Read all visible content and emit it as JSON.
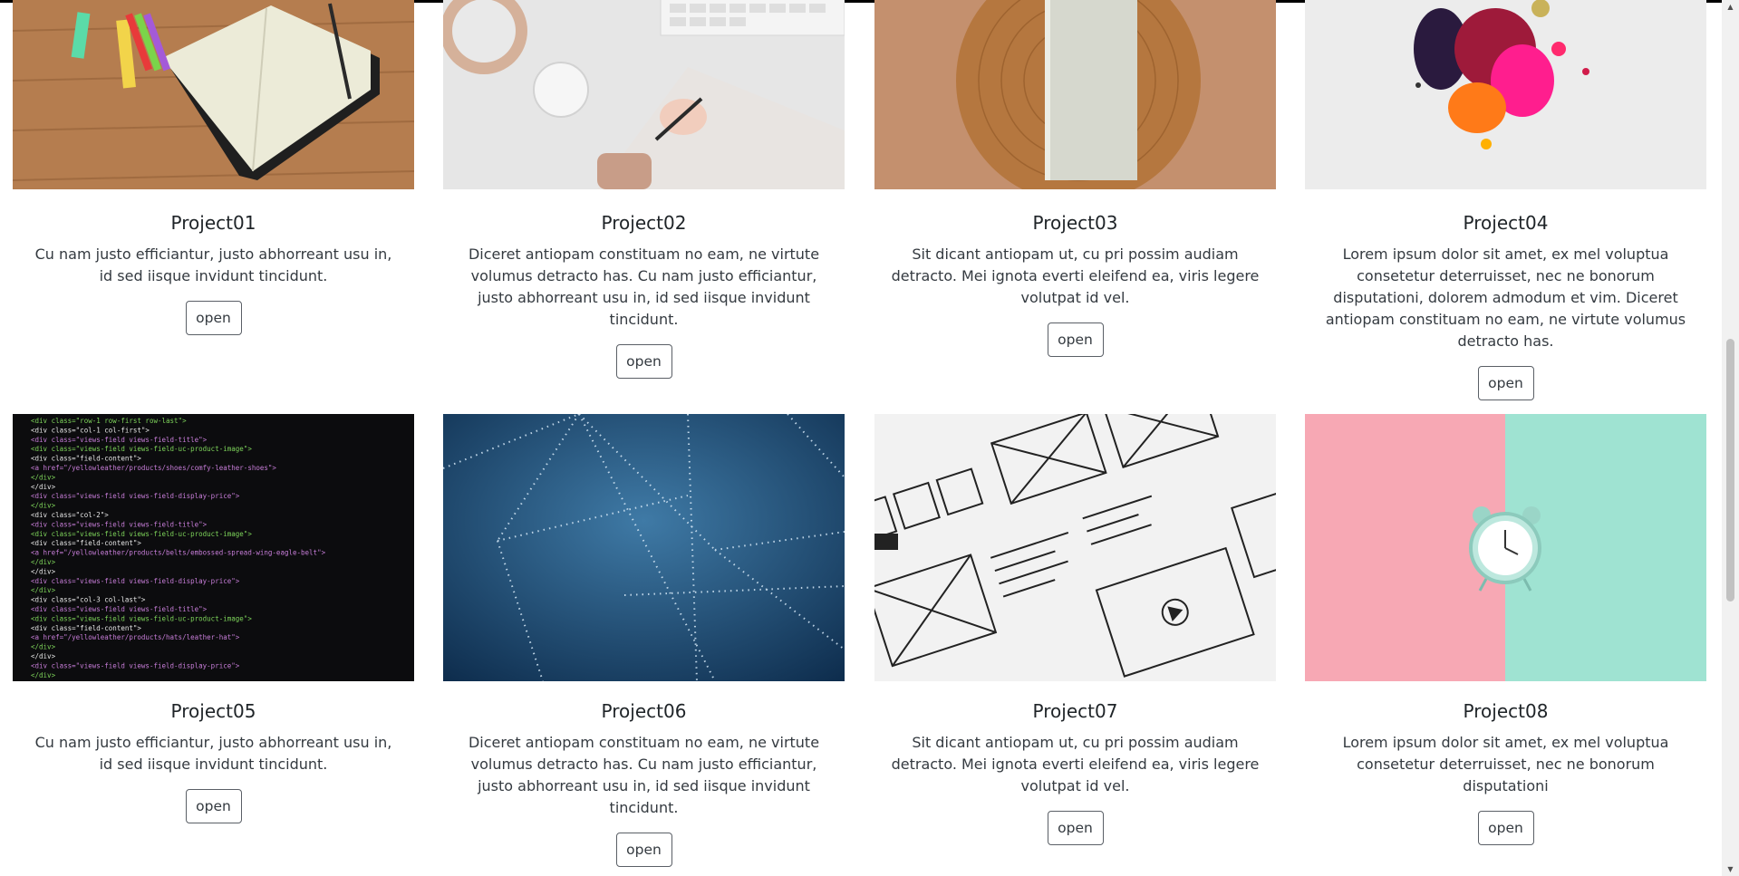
{
  "projects": [
    {
      "title": "Project01",
      "description": "Cu nam justo efficiantur, justo abhorreant usu in, id sed iisque invidunt tincidunt.",
      "button": "open"
    },
    {
      "title": "Project02",
      "description": "Diceret antiopam constituam no eam, ne virtute volumus detracto has. Cu nam justo efficiantur, justo abhorreant usu in, id sed iisque invidunt tincidunt.",
      "button": "open"
    },
    {
      "title": "Project03",
      "description": "Sit dicant antiopam ut, cu pri possim audiam detracto. Mei ignota everti eleifend ea, viris legere volutpat id vel.",
      "button": "open"
    },
    {
      "title": "Project04",
      "description": "Lorem ipsum dolor sit amet, ex mel voluptua consetetur deterruisset, nec ne bonorum disputationi, dolorem admodum et vim. Diceret antiopam constituam no eam, ne virtute volumus detracto has.",
      "button": "open"
    },
    {
      "title": "Project05",
      "description": "Cu nam justo efficiantur, justo abhorreant usu in, id sed iisque invidunt tincidunt.",
      "button": "open"
    },
    {
      "title": "Project06",
      "description": "Diceret antiopam constituam no eam, ne virtute volumus detracto has. Cu nam justo efficiantur, justo abhorreant usu in, id sed iisque invidunt tincidunt.",
      "button": "open"
    },
    {
      "title": "Project07",
      "description": "Sit dicant antiopam ut, cu pri possim audiam detracto. Mei ignota everti eleifend ea, viris legere volutpat id vel.",
      "button": "open"
    },
    {
      "title": "Project08",
      "description": "Lorem ipsum dolor sit amet, ex mel voluptua consetetur deterruisset, nec ne bonorum disputationi",
      "button": "open"
    }
  ],
  "code_lines": [
    "<div class=\"row-1 row-first row-last\">",
    "  <div class=\"col-1 col-first\">",
    "    <div class=\"views-field views-field-title\">",
    "    <div class=\"views-field views-field-uc-product-image\">",
    "      <div class=\"field-content\">",
    "        <a href=\"/yellowleather/products/shoes/comfy-leather-shoes\">",
    "      </div>",
    "    </div>",
    "    <div class=\"views-field views-field-display-price\">",
    "  </div>",
    "  <div class=\"col-2\">",
    "    <div class=\"views-field views-field-title\">",
    "    <div class=\"views-field views-field-uc-product-image\">",
    "      <div class=\"field-content\">",
    "        <a href=\"/yellowleather/products/belts/embossed-spread-wing-eagle-belt\">",
    "      </div>",
    "    </div>",
    "    <div class=\"views-field views-field-display-price\">",
    "  </div>",
    "  <div class=\"col-3 col-last\">",
    "    <div class=\"views-field views-field-title\">",
    "    <div class=\"views-field views-field-uc-product-image\">",
    "      <div class=\"field-content\">",
    "        <a href=\"/yellowleather/products/hats/leather-hat\">",
    "      </div>",
    "    </div>",
    "    <div class=\"views-field views-field-display-price\">",
    "  </div>"
  ],
  "colors": {
    "wood": "#b88050",
    "paper": "#e8e7df",
    "ink_blue": "#1d4a74",
    "pink": "#f7a8b4",
    "mint": "#9fe3d2",
    "code_bg": "#0c0c0e"
  }
}
